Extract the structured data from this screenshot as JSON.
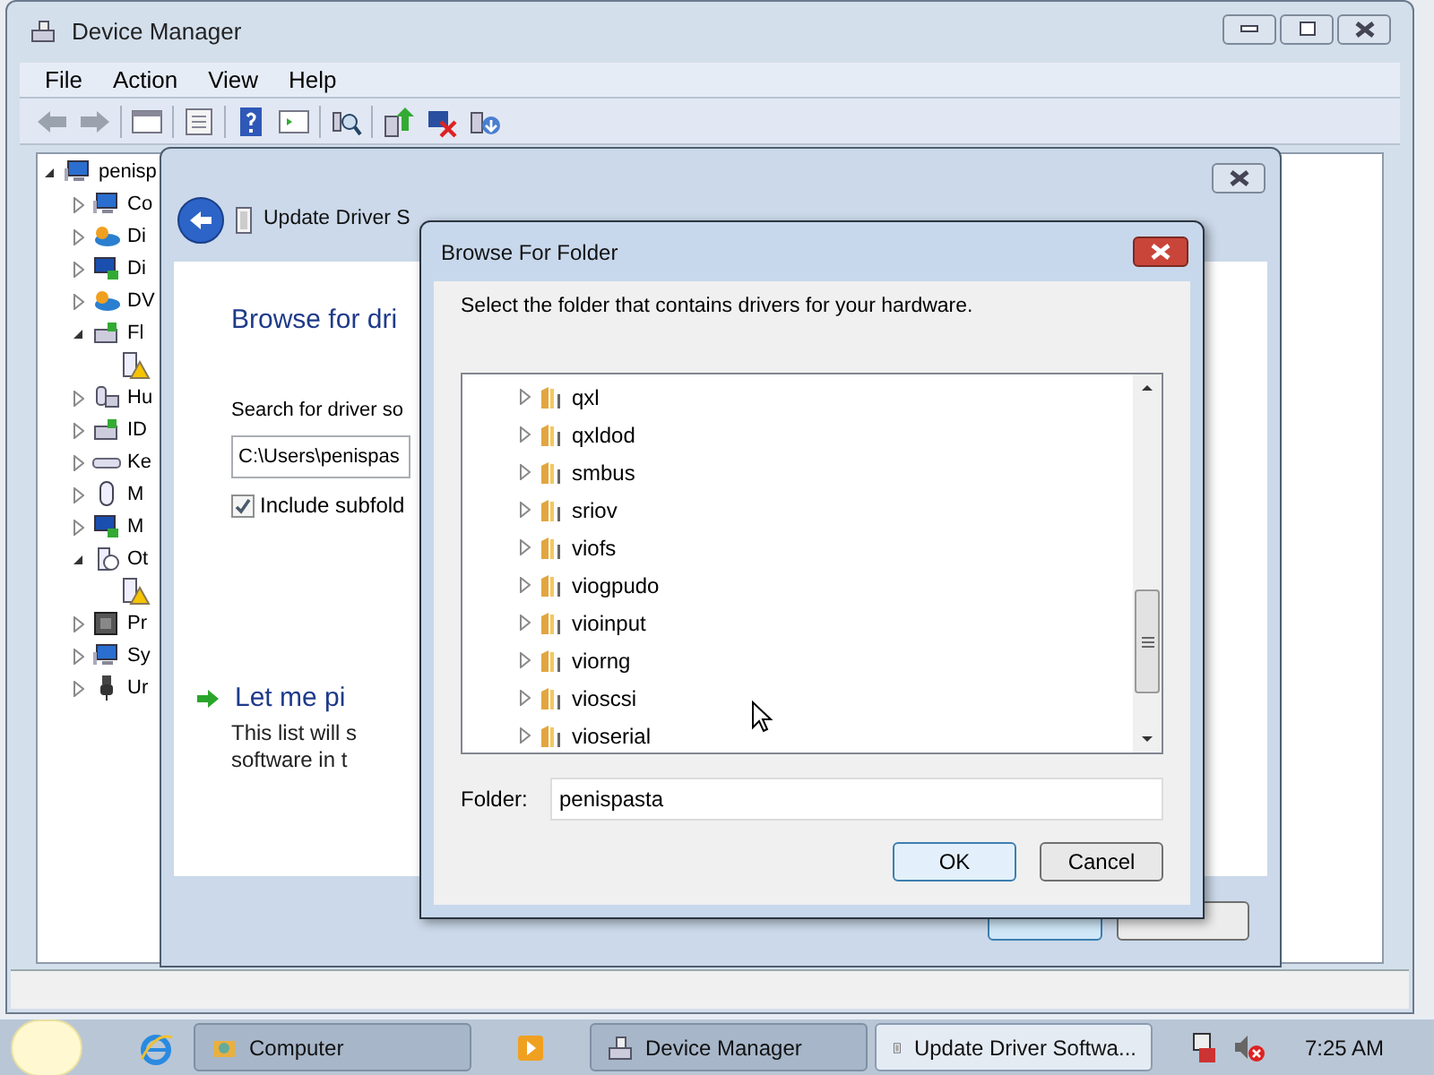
{
  "device_manager": {
    "title": "Device Manager",
    "menu": [
      "File",
      "Action",
      "View",
      "Help"
    ],
    "tree": {
      "label": "penisp",
      "kind": "computer",
      "expanded": true,
      "children": [
        {
          "label": "Co",
          "kind": "computer",
          "expanded": false
        },
        {
          "label": "Di",
          "kind": "disk",
          "expanded": false
        },
        {
          "label": "Di",
          "kind": "display",
          "expanded": false
        },
        {
          "label": "DV",
          "kind": "disk",
          "expanded": false
        },
        {
          "label": "Fl",
          "kind": "controller",
          "expanded": true,
          "children": [
            {
              "kind": "warning"
            }
          ]
        },
        {
          "label": "Hu",
          "kind": "hid",
          "expanded": false
        },
        {
          "label": "ID",
          "kind": "controller",
          "expanded": false
        },
        {
          "label": "Ke",
          "kind": "keyboard",
          "expanded": false
        },
        {
          "label": "M",
          "kind": "mouse",
          "expanded": false
        },
        {
          "label": "M",
          "kind": "display",
          "expanded": false
        },
        {
          "label": "Ot",
          "kind": "unknown",
          "expanded": true,
          "children": [
            {
              "kind": "warning"
            }
          ]
        },
        {
          "label": "Pr",
          "kind": "processor",
          "expanded": false
        },
        {
          "label": "Sy",
          "kind": "computer",
          "expanded": false
        },
        {
          "label": "Ur",
          "kind": "usb",
          "expanded": false
        }
      ]
    }
  },
  "update_driver": {
    "title": "Update Driver S",
    "heading": "Browse for dri",
    "search_label": "Search for driver so",
    "path": "C:\\Users\\penispas",
    "include_subfolders": {
      "label": "Include subfold",
      "checked": true
    },
    "pick": {
      "title": "Let me pi",
      "description": [
        "This list will s",
        "software in t"
      ]
    }
  },
  "browse_for_folder": {
    "title": "Browse For Folder",
    "instruction": "Select the folder that contains drivers for your hardware.",
    "folders": [
      {
        "name": "qxl",
        "expanded": false
      },
      {
        "name": "qxldod",
        "expanded": false
      },
      {
        "name": "smbus",
        "expanded": false
      },
      {
        "name": "sriov",
        "expanded": false
      },
      {
        "name": "viofs",
        "expanded": false
      },
      {
        "name": "viogpudo",
        "expanded": false
      },
      {
        "name": "vioinput",
        "expanded": false
      },
      {
        "name": "viorng",
        "expanded": false
      },
      {
        "name": "vioscsi",
        "expanded": false
      },
      {
        "name": "vioserial",
        "expanded": false
      }
    ],
    "folder_label": "Folder:",
    "folder_value": "penispasta",
    "buttons": [
      {
        "label": "OK",
        "default": true
      },
      {
        "label": "Cancel",
        "default": false
      }
    ]
  },
  "taskbar": {
    "pinned": [
      {
        "kind": "browser"
      }
    ],
    "buttons": [
      {
        "label": "Computer",
        "kind": "explorer",
        "active": false
      },
      {
        "label": "Device Manager",
        "kind": "device",
        "active": false
      },
      {
        "label": "Update Driver Softwa...",
        "kind": "driver",
        "active": true
      }
    ],
    "clock": "7:25 AM"
  }
}
